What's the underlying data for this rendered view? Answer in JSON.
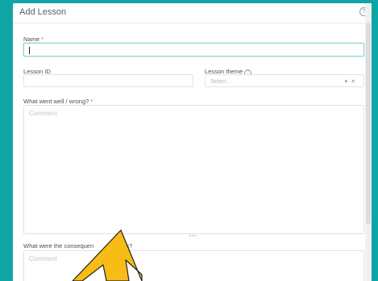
{
  "dialog": {
    "title": "Add Lesson",
    "help_icon": "question-circle-icon"
  },
  "fields": {
    "name": {
      "label": "Name",
      "required_mark": "*",
      "value": ""
    },
    "lesson_id": {
      "label": "Lesson ID",
      "value": ""
    },
    "lesson_theme": {
      "label": "Lesson theme",
      "placeholder": "Select...",
      "help_icon": "question-circle-icon",
      "dropdown_icon": "chevron-down-icon",
      "clear_icon": "close-icon"
    },
    "went_well": {
      "label": "What went well / wrong?",
      "required_mark": "*",
      "placeholder": "Comment"
    },
    "consequences": {
      "label_part1": "What were the consequen",
      "label_part2": "/ actions?",
      "placeholder": "Comment"
    }
  },
  "colors": {
    "background": "#0fa5a5",
    "panel": "#ffffff",
    "required": "#e2574c",
    "arrow_fill": "#f7bc15",
    "arrow_stroke": "#222222"
  }
}
